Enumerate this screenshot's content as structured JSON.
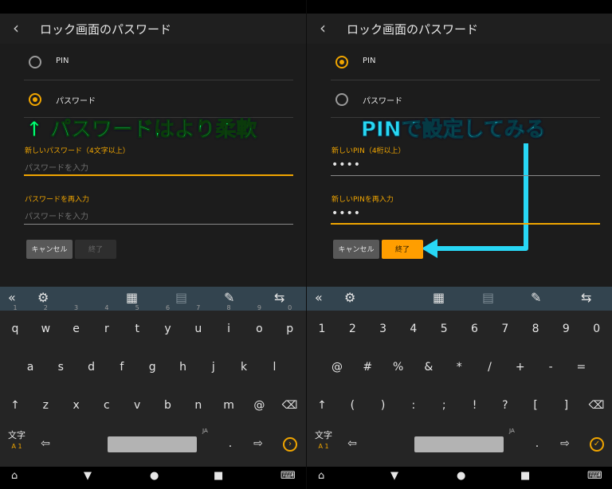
{
  "left": {
    "title": "ロック画面のパスワード",
    "radio_pin": "PIN",
    "radio_password": "パスワード",
    "field1_label": "新しいパスワード（4文字以上）",
    "field1_placeholder": "パスワードを入力",
    "field2_label": "パスワードを再入力",
    "field2_placeholder": "パスワードを入力",
    "cancel": "キャンセル",
    "done": "終了",
    "callout": "↑ パスワードはより柔軟",
    "row1": [
      [
        "q",
        "1"
      ],
      [
        "w",
        "2"
      ],
      [
        "e",
        "3"
      ],
      [
        "r",
        "4"
      ],
      [
        "t",
        "5"
      ],
      [
        "y",
        "6"
      ],
      [
        "u",
        "7"
      ],
      [
        "i",
        "8"
      ],
      [
        "o",
        "9"
      ],
      [
        "p",
        "0"
      ]
    ],
    "row2": [
      "a",
      "s",
      "d",
      "f",
      "g",
      "h",
      "j",
      "k",
      "l"
    ],
    "row3": [
      "↑",
      "z",
      "x",
      "c",
      "v",
      "b",
      "n",
      "m",
      "@",
      "⌫"
    ],
    "row4_mode": "文字",
    "row4_mode_sub": "A 1"
  },
  "right": {
    "title": "ロック画面のパスワード",
    "radio_pin": "PIN",
    "radio_password": "パスワード",
    "field1_label": "新しいPIN（4桁以上）",
    "field1_value": "••••",
    "field2_label": "新しいPINを再入力",
    "field2_value": "••••",
    "cancel": "キャンセル",
    "done": "終了",
    "callout": "PINで設定してみる",
    "row1": [
      "1",
      "2",
      "3",
      "4",
      "5",
      "6",
      "7",
      "8",
      "9",
      "0"
    ],
    "row2": [
      "@",
      "#",
      "%",
      "&",
      "*",
      "/",
      "+",
      "-",
      "="
    ],
    "row3": [
      "↑",
      "(",
      ")",
      ":",
      ";",
      "!",
      "?",
      "[",
      "]",
      "⌫"
    ],
    "row4_mode": "文字",
    "row4_mode_sub": "A 1"
  },
  "keyboard": {
    "space_hint": "JA",
    "period": ".",
    "comma": ",",
    "dots": "..."
  },
  "accent": "#f0a500"
}
